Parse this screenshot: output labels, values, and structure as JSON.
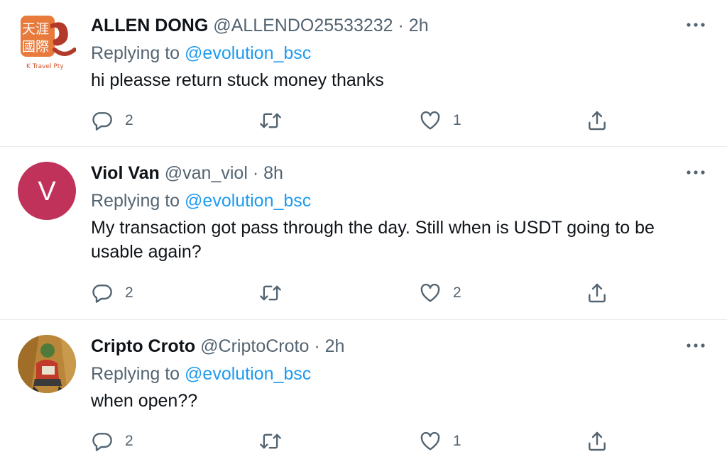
{
  "replies": [
    {
      "name": "ALLEN DONG",
      "handle": "@ALLENDO25533232",
      "time": "2h",
      "replying_label": "Replying to",
      "mention": "@evolution_bsc",
      "text": "hi pleasse return stuck money thanks",
      "reply_count": "2",
      "like_count": "1",
      "avatar_text": "天涯國際",
      "avatar_caption": "K Travel Pty"
    },
    {
      "name": "Viol Van",
      "handle": "@van_viol",
      "time": "8h",
      "replying_label": "Replying to",
      "mention": "@evolution_bsc",
      "text": "My transaction got pass through the day. Still when is USDT going to be usable again?",
      "reply_count": "2",
      "like_count": "2",
      "avatar_letter": "V"
    },
    {
      "name": "Cripto Croto",
      "handle": "@CriptoCroto",
      "time": "2h",
      "replying_label": "Replying to",
      "mention": "@evolution_bsc",
      "text": "when open??",
      "reply_count": "2",
      "like_count": "1"
    }
  ],
  "separator": "·",
  "colors": {
    "mention": "#1d9bf0",
    "secondary_text": "#536471",
    "divider": "#e6ecf0",
    "avatar_v": "#c0325a"
  }
}
